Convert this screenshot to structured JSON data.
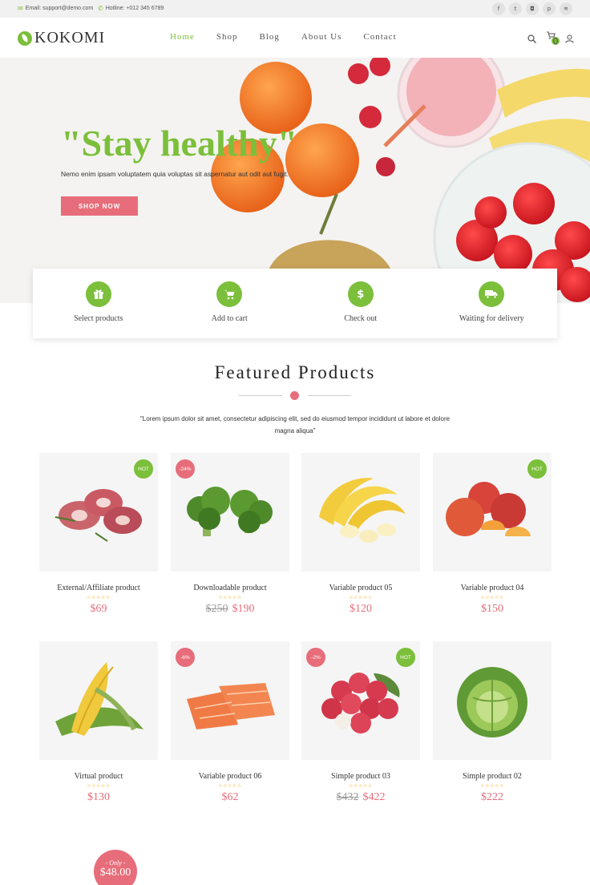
{
  "topbar": {
    "email": "Email: support@demo.com",
    "hotline": "Hotline: +012 345 6789",
    "social": [
      "f",
      "t",
      "ig",
      "p",
      "rss"
    ]
  },
  "header": {
    "logo": "KOKOMI",
    "nav": [
      "Home",
      "Shop",
      "Blog",
      "About Us",
      "Contact"
    ],
    "active_nav": "Home",
    "cart_count": "0"
  },
  "hero": {
    "title": "\"Stay healthy\"",
    "subtitle": "Nemo enim ipsam voluptatem quia voluptas sit aspernatur aut odit aut fugit.",
    "cta": "SHOP NOW"
  },
  "features": [
    {
      "label": "Select products",
      "icon": "gift-icon"
    },
    {
      "label": "Add to cart",
      "icon": "cart-icon"
    },
    {
      "label": "Check out",
      "icon": "dollar-icon"
    },
    {
      "label": "Waiting for delivery",
      "icon": "truck-icon"
    }
  ],
  "featured": {
    "title": "Featured Products",
    "description": "\"Lorem ipsum dolor sit amet, consectetur adipiscing elit, sed do eiusmod tempor incididunt ut labore et dolore magna aliqua\""
  },
  "products": [
    {
      "name": "External/Affiliate product",
      "price": "$69",
      "old_price": "",
      "badge_hot": "HOT",
      "badge_sale": "",
      "stars": "☆☆☆☆☆",
      "image": "meat"
    },
    {
      "name": "Downloadable product",
      "price": "$190",
      "old_price": "$250",
      "badge_hot": "",
      "badge_sale": "-24%",
      "stars": "☆☆☆☆☆",
      "image": "broccoli"
    },
    {
      "name": "Variable product 05",
      "price": "$120",
      "old_price": "",
      "badge_hot": "",
      "badge_sale": "",
      "stars": "☆☆☆☆☆",
      "image": "banana"
    },
    {
      "name": "Variable product 04",
      "price": "$150",
      "old_price": "",
      "badge_hot": "HOT",
      "badge_sale": "",
      "stars": "☆☆☆☆☆",
      "image": "peach"
    },
    {
      "name": "Virtual product",
      "price": "$130",
      "old_price": "",
      "badge_hot": "",
      "badge_sale": "",
      "stars": "☆☆☆☆☆",
      "image": "corn"
    },
    {
      "name": "Variable product 06",
      "price": "$62",
      "old_price": "",
      "badge_hot": "",
      "badge_sale": "-6%",
      "stars": "☆☆☆☆☆",
      "image": "salmon"
    },
    {
      "name": "Simple product 03",
      "price": "$422",
      "old_price": "$432",
      "badge_hot": "HOT",
      "badge_sale": "-2%",
      "stars": "☆☆☆☆☆",
      "image": "lychee"
    },
    {
      "name": "Simple product 02",
      "price": "$222",
      "old_price": "",
      "badge_hot": "",
      "badge_sale": "",
      "stars": "☆☆☆☆☆",
      "image": "cabbage"
    }
  ],
  "deal": {
    "only": "- Only -",
    "amount": "$48.00"
  },
  "colors": {
    "accent_green": "#7bbf3a",
    "accent_pink": "#e76d7a"
  }
}
